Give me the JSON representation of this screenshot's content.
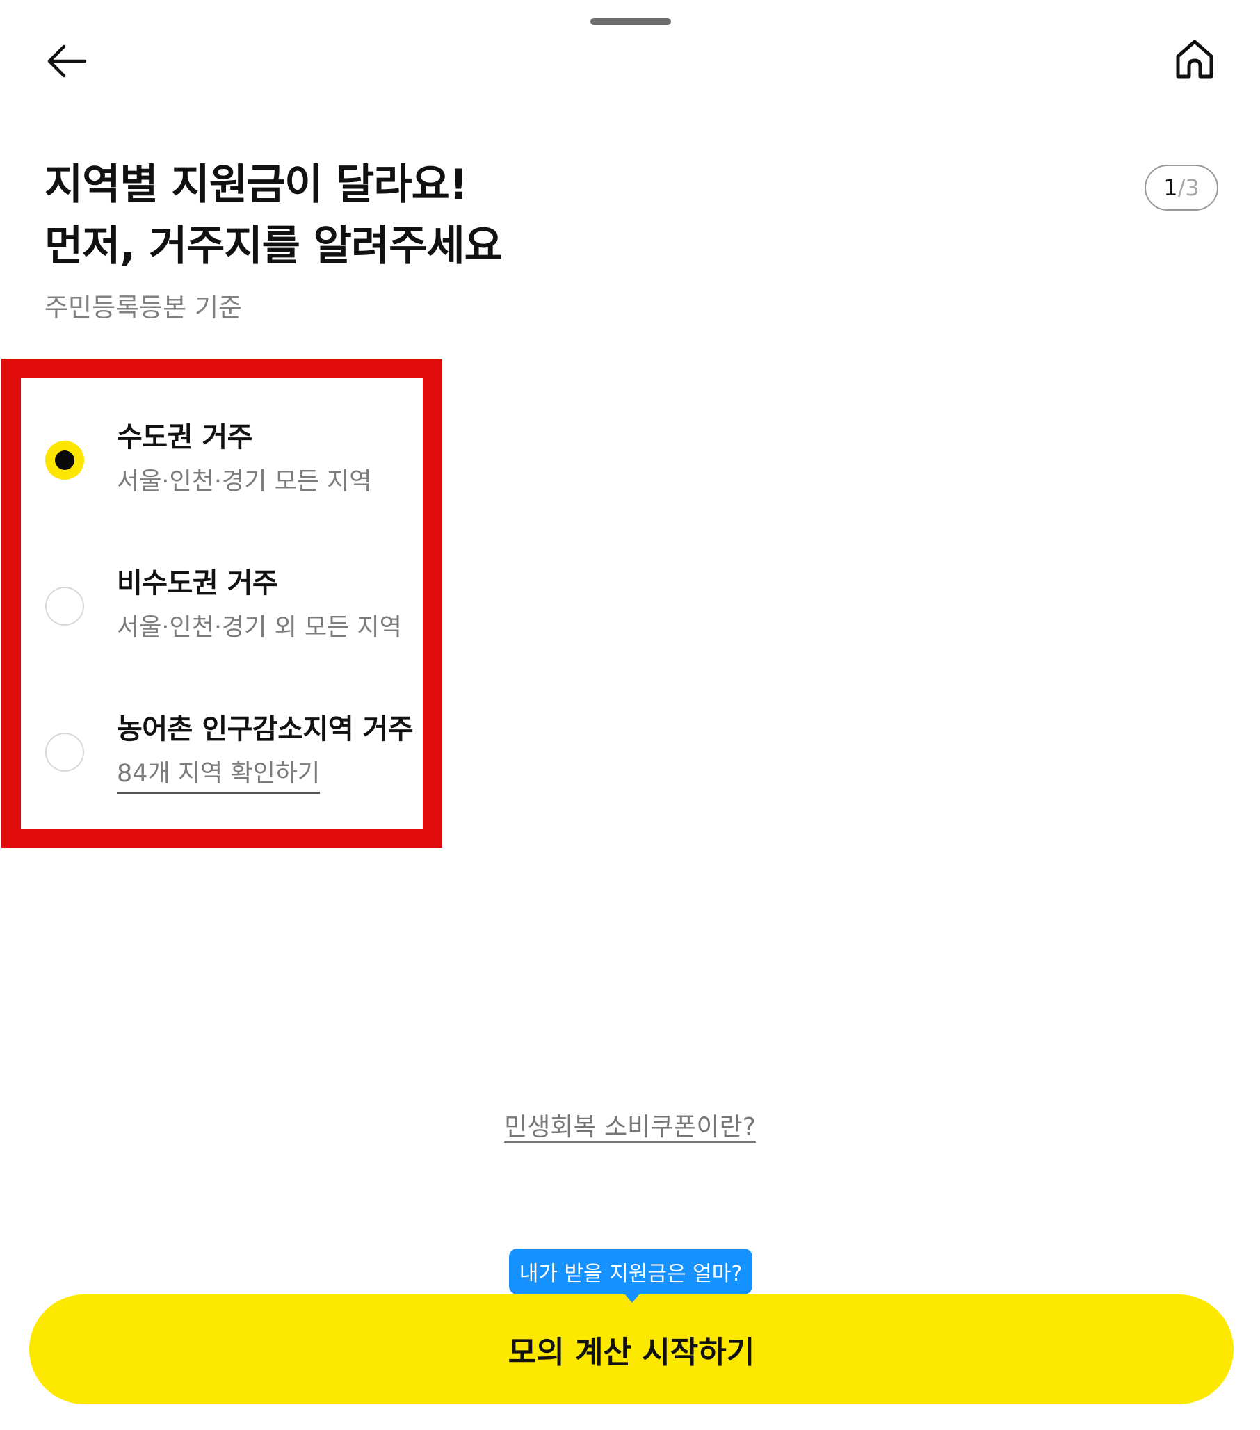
{
  "header": {
    "back_icon": "arrow-left-icon",
    "home_icon": "home-icon"
  },
  "title": {
    "line1": "지역별 지원금이 달라요!",
    "line2": "먼저, 거주지를 알려주세요"
  },
  "subtitle": "주민등록등본 기준",
  "step": {
    "current": "1",
    "separator": "/",
    "total": "3"
  },
  "options": [
    {
      "label": "수도권 거주",
      "description": "서울·인천·경기 모든 지역",
      "selected": true
    },
    {
      "label": "비수도권 거주",
      "description": "서울·인천·경기 외 모든 지역",
      "selected": false
    },
    {
      "label": "농어촌 인구감소지역 거주",
      "link": "84개 지역 확인하기",
      "selected": false
    }
  ],
  "info_link": "민생회복 소비쿠폰이란?",
  "tooltip": "내가 받을 지원금은 얼마?",
  "cta": "모의 계산 시작하기",
  "colors": {
    "accent_yellow": "#fde800",
    "highlight_red": "#e00b0b",
    "tooltip_blue": "#1592ff"
  }
}
